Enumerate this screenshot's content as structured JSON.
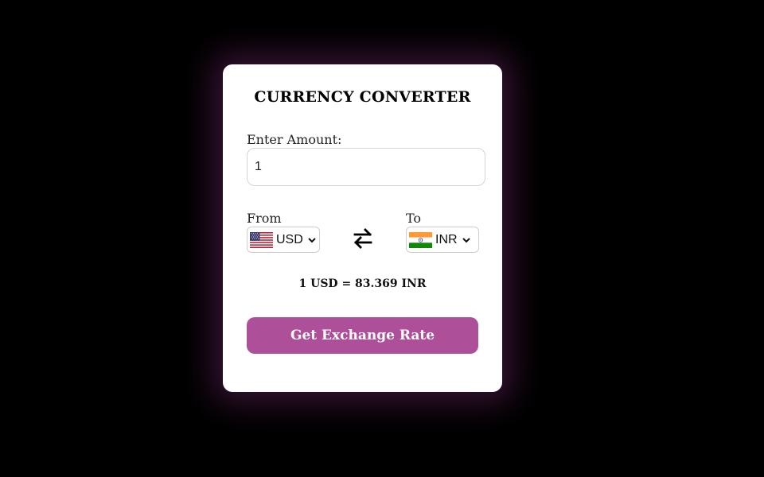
{
  "app": {
    "title": "CURRENCY CONVERTER"
  },
  "amount": {
    "label": "Enter Amount:",
    "value": "1"
  },
  "from": {
    "label": "From",
    "currency": "USD",
    "flag_icon": "us-flag-icon"
  },
  "to": {
    "label": "To",
    "currency": "INR",
    "flag_icon": "india-flag-icon"
  },
  "swap_icon": "swap-arrows-icon",
  "rate_text": "1 USD = 83.369 INR",
  "button": {
    "label": "Get Exchange Rate"
  },
  "colors": {
    "background": "#000000",
    "card": "#ffffff",
    "button": "#ad4f99",
    "glow": "#78286e"
  }
}
